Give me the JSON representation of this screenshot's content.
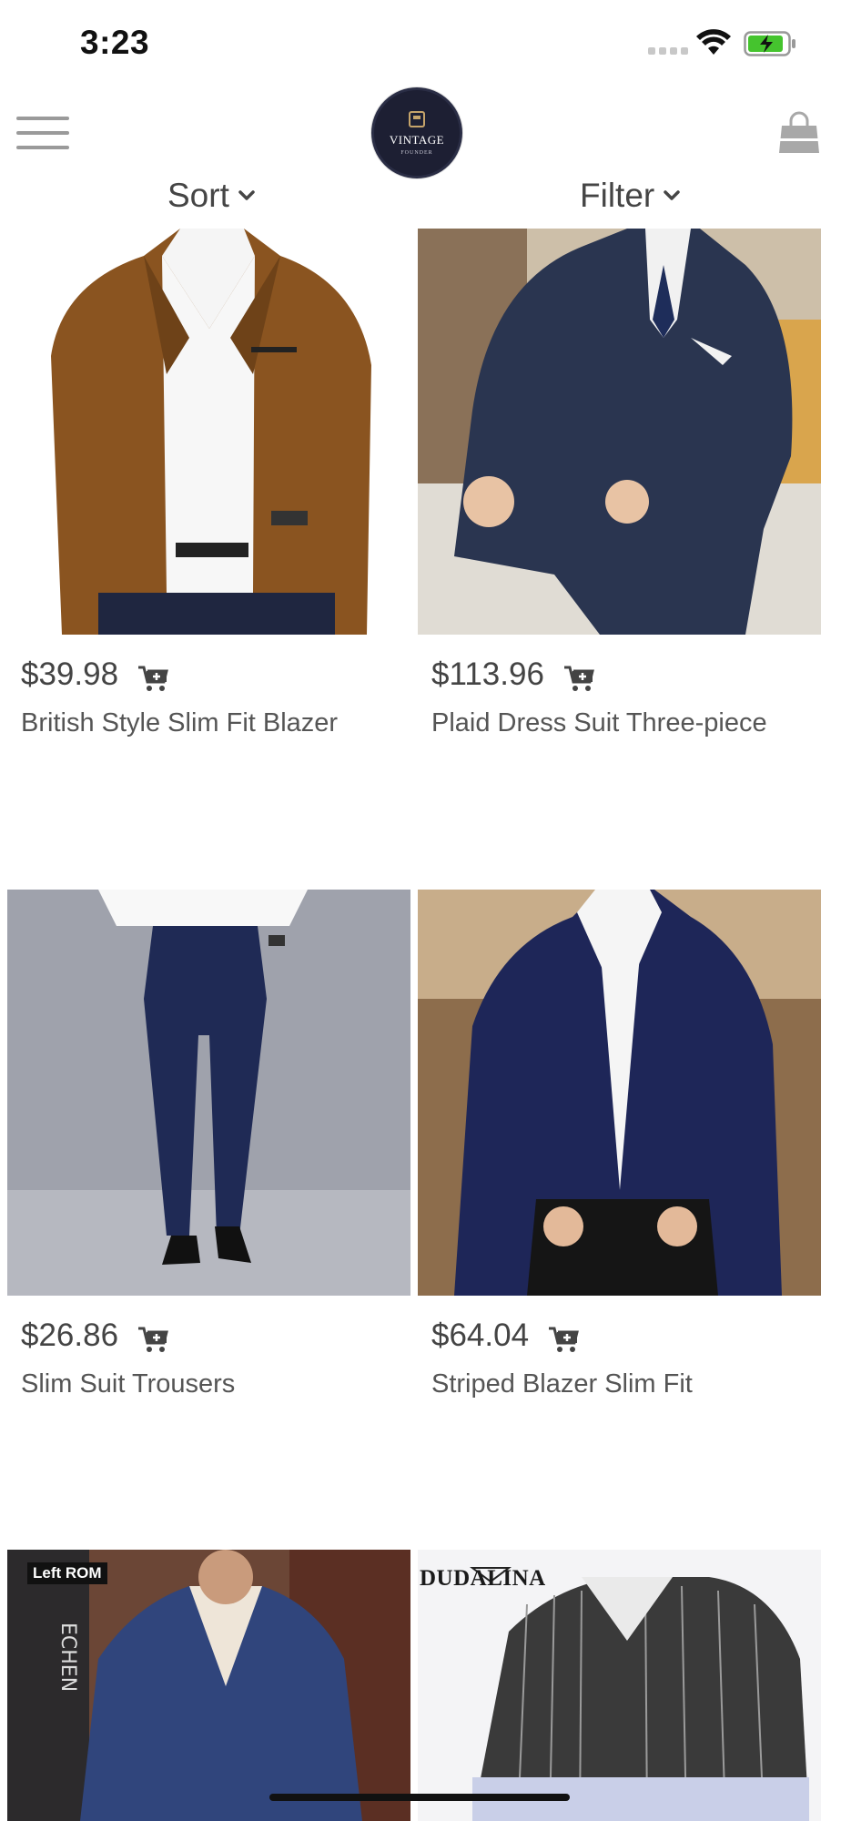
{
  "status_bar": {
    "time": "3:23"
  },
  "header": {
    "logo_name": "VINTAGE",
    "logo_sub": "FOUNDER"
  },
  "toolbar": {
    "sort_label": "Sort",
    "filter_label": "Filter"
  },
  "products": [
    {
      "price": "$39.98",
      "name": "British Style Slim Fit Blazer"
    },
    {
      "price": "$113.96",
      "name": "Plaid Dress Suit Three-piece"
    },
    {
      "price": "$26.86",
      "name": "Slim Suit Trousers"
    },
    {
      "price": "$64.04",
      "name": "Striped Blazer Slim Fit"
    },
    {
      "badge": "Left ROM",
      "image_text": "ECHEN"
    },
    {
      "brand": "DUDALINA"
    }
  ],
  "icons": {
    "menu": "hamburger-menu-icon",
    "cart": "shopping-bag-icon",
    "add_to_cart": "cart-plus-icon",
    "chevron": "chevron-down-icon"
  },
  "colors": {
    "logo_bg": "#1d1f33",
    "logo_accent": "#c6a46a",
    "battery_green": "#45c42e"
  }
}
